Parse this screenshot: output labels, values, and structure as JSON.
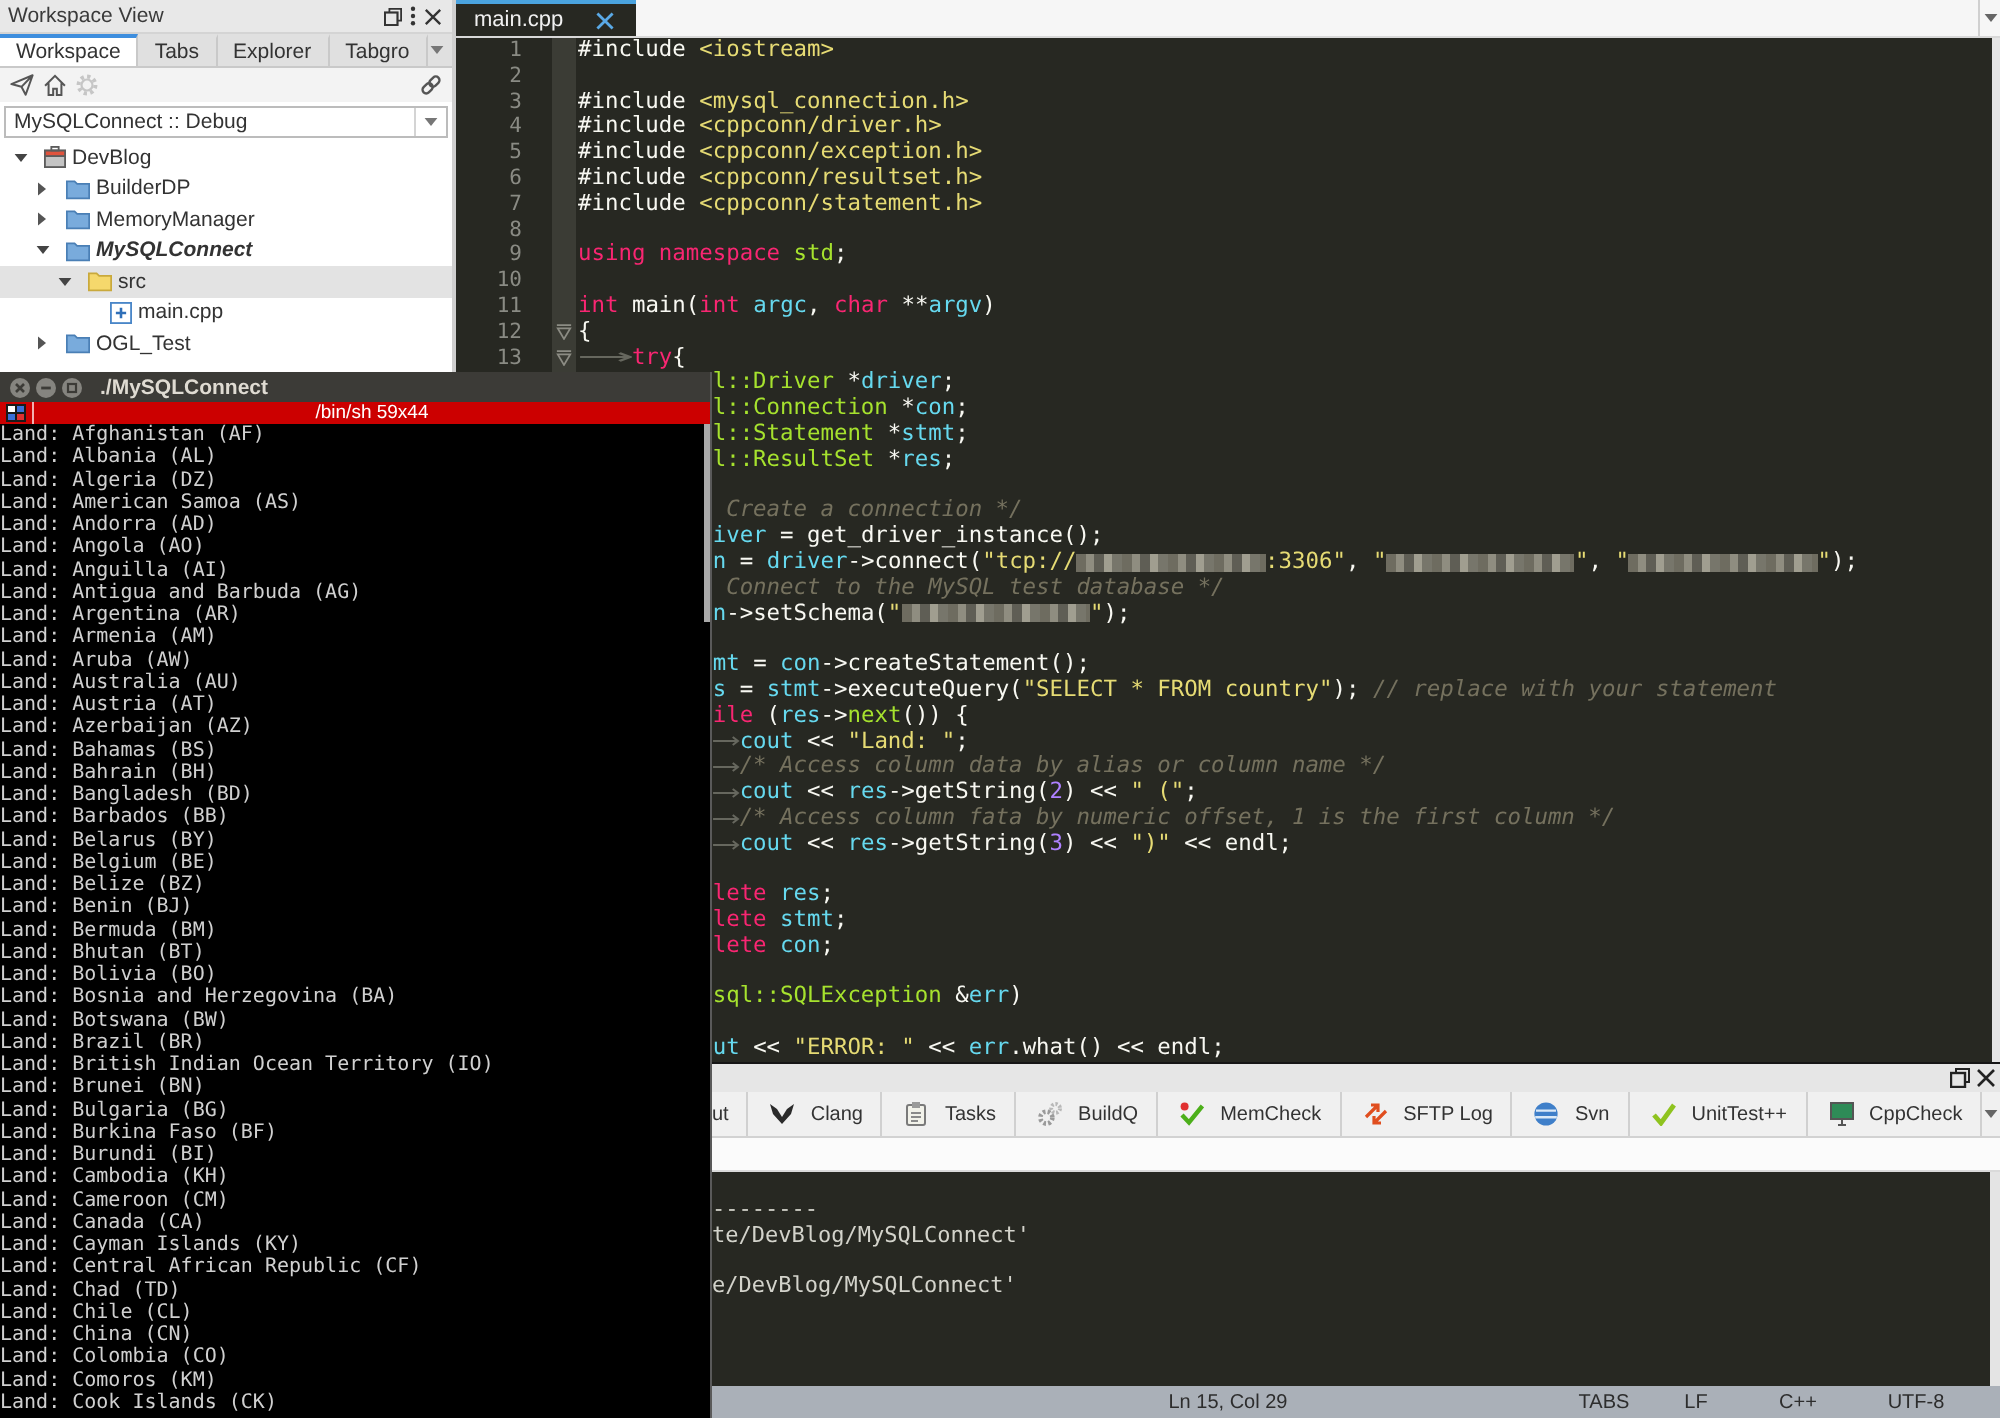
{
  "workspace_view": {
    "title": "Workspace View",
    "tabs": [
      {
        "label": "Workspace",
        "selected": true
      },
      {
        "label": "Tabs",
        "selected": false
      },
      {
        "label": "Explorer",
        "selected": false
      },
      {
        "label": "Tabgro",
        "selected": false
      }
    ],
    "toolbar": {
      "start": [
        {
          "kind": "plane",
          "disabled": false
        },
        {
          "kind": "home",
          "disabled": false
        },
        {
          "kind": "gear",
          "disabled": true
        }
      ],
      "end": [
        {
          "kind": "link",
          "disabled": false
        }
      ]
    },
    "configuration": "MySQLConnect :: Debug",
    "tree": [
      {
        "label": "DevBlog",
        "kind": "workspace",
        "expanded": true,
        "selected": false,
        "active": false,
        "children": [
          {
            "label": "BuilderDP",
            "kind": "project",
            "expanded": false,
            "selected": false,
            "active": false
          },
          {
            "label": "MemoryManager",
            "kind": "project",
            "expanded": false,
            "selected": false,
            "active": false
          },
          {
            "label": "MySQLConnect",
            "kind": "project",
            "expanded": true,
            "selected": false,
            "active": true,
            "children": [
              {
                "label": "src",
                "kind": "folder",
                "expanded": true,
                "selected": true,
                "active": false,
                "children": [
                  {
                    "label": "main.cpp",
                    "kind": "file",
                    "selected": false,
                    "active": false
                  }
                ]
              }
            ]
          },
          {
            "label": "OGL_Test",
            "kind": "project",
            "expanded": false,
            "selected": false,
            "active": false
          }
        ]
      }
    ]
  },
  "editor": {
    "tabs": [
      {
        "label": "main.cpp",
        "selected": true
      }
    ],
    "lines": [
      {
        "number": "1",
        "fold": false,
        "tokens": [
          {
            "kind": "plain",
            "text": "#include "
          },
          {
            "kind": "string",
            "text": "<iostream>"
          }
        ]
      },
      {
        "number": "2",
        "fold": false
      },
      {
        "number": "3",
        "fold": false,
        "tokens": [
          {
            "kind": "plain",
            "text": "#include "
          },
          {
            "kind": "string",
            "text": "<mysql_connection.h>"
          }
        ]
      },
      {
        "number": "4",
        "fold": false,
        "tokens": [
          {
            "kind": "plain",
            "text": "#include "
          },
          {
            "kind": "string",
            "text": "<cppconn/driver.h>"
          }
        ]
      },
      {
        "number": "5",
        "fold": false,
        "tokens": [
          {
            "kind": "plain",
            "text": "#include "
          },
          {
            "kind": "string",
            "text": "<cppconn/exception.h>"
          }
        ]
      },
      {
        "number": "6",
        "fold": false,
        "tokens": [
          {
            "kind": "plain",
            "text": "#include "
          },
          {
            "kind": "string",
            "text": "<cppconn/resultset.h>"
          }
        ]
      },
      {
        "number": "7",
        "fold": false,
        "tokens": [
          {
            "kind": "plain",
            "text": "#include "
          },
          {
            "kind": "string",
            "text": "<cppconn/statement.h>"
          }
        ]
      },
      {
        "number": "8",
        "fold": false
      },
      {
        "number": "9",
        "fold": false,
        "tokens": [
          {
            "kind": "keyword",
            "text": "using"
          },
          {
            "kind": "keyword",
            "text": " namespace"
          },
          {
            "kind": "type",
            "text": " std"
          },
          {
            "kind": "plain",
            "text": ";"
          }
        ]
      },
      {
        "number": "10",
        "fold": false
      },
      {
        "number": "11",
        "fold": false,
        "tokens": [
          {
            "kind": "keyword",
            "text": "int"
          },
          {
            "kind": "plain",
            "text": " main("
          },
          {
            "kind": "keyword",
            "text": "int"
          },
          {
            "kind": "ident",
            "text": " argc"
          },
          {
            "kind": "plain",
            "text": ", "
          },
          {
            "kind": "keyword",
            "text": "char"
          },
          {
            "kind": "plain",
            "text": " **"
          },
          {
            "kind": "ident",
            "text": "argv"
          },
          {
            "kind": "plain",
            "text": ")"
          }
        ]
      },
      {
        "number": "12",
        "fold": true,
        "tokens": [
          {
            "kind": "plain",
            "text": "{"
          }
        ]
      },
      {
        "number": "13",
        "fold": true,
        "tokens": [
          {
            "kind": "tab"
          },
          {
            "kind": "keyword",
            "text": "try"
          },
          {
            "kind": "plain",
            "text": "{"
          }
        ]
      }
    ],
    "clipped_blocks": [
      {
        "lines": [
          {
            "tokens": [
              {
                "kind": "type",
                "text": "l::Driver"
              },
              {
                "kind": "plain",
                "text": " *"
              },
              {
                "kind": "ident",
                "text": "driver"
              },
              {
                "kind": "plain",
                "text": ";"
              }
            ]
          },
          {
            "tokens": [
              {
                "kind": "type",
                "text": "l::Connection"
              },
              {
                "kind": "plain",
                "text": " *"
              },
              {
                "kind": "ident",
                "text": "con"
              },
              {
                "kind": "plain",
                "text": ";"
              }
            ]
          },
          {
            "tokens": [
              {
                "kind": "type",
                "text": "l::Statement"
              },
              {
                "kind": "plain",
                "text": " *"
              },
              {
                "kind": "ident",
                "text": "stmt"
              },
              {
                "kind": "plain",
                "text": ";"
              }
            ]
          },
          {
            "tokens": [
              {
                "kind": "type",
                "text": "l::ResultSet"
              },
              {
                "kind": "plain",
                "text": " *"
              },
              {
                "kind": "ident",
                "text": "res"
              },
              {
                "kind": "plain",
                "text": ";"
              }
            ]
          }
        ]
      },
      {
        "lines": [
          {
            "tokens": [
              {
                "kind": "comment",
                "text": " Create a connection */"
              }
            ]
          },
          {
            "tokens": [
              {
                "kind": "ident",
                "text": "iver"
              },
              {
                "kind": "plain",
                "text": " = get_driver_instance();"
              }
            ]
          },
          {
            "tokens": [
              {
                "kind": "ident",
                "text": "n"
              },
              {
                "kind": "plain",
                "text": " = "
              },
              {
                "kind": "ident",
                "text": "driver"
              },
              {
                "kind": "plain",
                "text": "->connect("
              },
              {
                "kind": "string",
                "text": "\"tcp://"
              },
              {
                "kind": "redacted"
              },
              {
                "kind": "string",
                "text": ":3306\""
              },
              {
                "kind": "plain",
                "text": ", "
              },
              {
                "kind": "string",
                "text": "\""
              },
              {
                "kind": "redacted"
              },
              {
                "kind": "string",
                "text": "\""
              },
              {
                "kind": "plain",
                "text": ", "
              },
              {
                "kind": "string",
                "text": "\""
              },
              {
                "kind": "redacted"
              },
              {
                "kind": "string",
                "text": "\""
              },
              {
                "kind": "plain",
                "text": ");"
              }
            ]
          },
          {
            "tokens": [
              {
                "kind": "comment",
                "text": " Connect to the MySQL test database */"
              }
            ]
          },
          {
            "tokens": [
              {
                "kind": "ident",
                "text": "n"
              },
              {
                "kind": "plain",
                "text": "->setSchema("
              },
              {
                "kind": "string",
                "text": "\""
              },
              {
                "kind": "redacted"
              },
              {
                "kind": "string",
                "text": "\""
              },
              {
                "kind": "plain",
                "text": ");"
              }
            ]
          }
        ]
      },
      {
        "lines": [
          {
            "tokens": [
              {
                "kind": "ident",
                "text": "mt"
              },
              {
                "kind": "plain",
                "text": " = "
              },
              {
                "kind": "ident",
                "text": "con"
              },
              {
                "kind": "plain",
                "text": "->createStatement();"
              }
            ]
          },
          {
            "tokens": [
              {
                "kind": "ident",
                "text": "s"
              },
              {
                "kind": "plain",
                "text": " = "
              },
              {
                "kind": "ident",
                "text": "stmt"
              },
              {
                "kind": "plain",
                "text": "->executeQuery("
              },
              {
                "kind": "string",
                "text": "\"SELECT * FROM country\""
              },
              {
                "kind": "plain",
                "text": "); "
              },
              {
                "kind": "comment",
                "text": "// replace with your statement"
              }
            ]
          },
          {
            "tokens": [
              {
                "kind": "keyword",
                "text": "ile"
              },
              {
                "kind": "plain",
                "text": " ("
              },
              {
                "kind": "ident",
                "text": "res"
              },
              {
                "kind": "plain",
                "text": "->"
              },
              {
                "kind": "function",
                "text": "next"
              },
              {
                "kind": "plain",
                "text": "()) {"
              }
            ]
          },
          {
            "tokens": [
              {
                "kind": "tab"
              },
              {
                "kind": "ident",
                "text": "cout"
              },
              {
                "kind": "plain",
                "text": " << "
              },
              {
                "kind": "string",
                "text": "\"Land: \""
              },
              {
                "kind": "plain",
                "text": ";"
              }
            ]
          },
          {
            "tokens": [
              {
                "kind": "tab"
              },
              {
                "kind": "comment",
                "text": "/* Access column data by alias or column name */"
              }
            ]
          },
          {
            "tokens": [
              {
                "kind": "tab"
              },
              {
                "kind": "ident",
                "text": "cout"
              },
              {
                "kind": "plain",
                "text": " << "
              },
              {
                "kind": "ident",
                "text": "res"
              },
              {
                "kind": "plain",
                "text": "->getString("
              },
              {
                "kind": "number",
                "text": "2"
              },
              {
                "kind": "plain",
                "text": ") << "
              },
              {
                "kind": "string",
                "text": "\" (\""
              },
              {
                "kind": "plain",
                "text": ";"
              }
            ]
          },
          {
            "tokens": [
              {
                "kind": "tab"
              },
              {
                "kind": "comment",
                "text": "/* Access column fata by numeric offset, 1 is the first column */"
              }
            ]
          },
          {
            "tokens": [
              {
                "kind": "tab"
              },
              {
                "kind": "ident",
                "text": "cout"
              },
              {
                "kind": "plain",
                "text": " << "
              },
              {
                "kind": "ident",
                "text": "res"
              },
              {
                "kind": "plain",
                "text": "->getString("
              },
              {
                "kind": "number",
                "text": "3"
              },
              {
                "kind": "plain",
                "text": ") << "
              },
              {
                "kind": "string",
                "text": "\")\""
              },
              {
                "kind": "plain",
                "text": " << endl;"
              }
            ]
          }
        ]
      },
      {
        "lines": [
          {
            "tokens": [
              {
                "kind": "keyword",
                "text": "lete"
              },
              {
                "kind": "ident",
                "text": " res"
              },
              {
                "kind": "plain",
                "text": ";"
              }
            ]
          },
          {
            "tokens": [
              {
                "kind": "keyword",
                "text": "lete"
              },
              {
                "kind": "ident",
                "text": " stmt"
              },
              {
                "kind": "plain",
                "text": ";"
              }
            ]
          },
          {
            "tokens": [
              {
                "kind": "keyword",
                "text": "lete"
              },
              {
                "kind": "ident",
                "text": " con"
              },
              {
                "kind": "plain",
                "text": ";"
              }
            ]
          }
        ]
      },
      {
        "lines": [
          {
            "tokens": [
              {
                "kind": "type",
                "text": "sql::SQLException"
              },
              {
                "kind": "plain",
                "text": " &"
              },
              {
                "kind": "ident",
                "text": "err"
              },
              {
                "kind": "plain",
                "text": ")"
              }
            ]
          }
        ]
      },
      {
        "lines": [
          {
            "tokens": [
              {
                "kind": "ident",
                "text": "ut"
              },
              {
                "kind": "plain",
                "text": " << "
              },
              {
                "kind": "string",
                "text": "\"ERROR: \""
              },
              {
                "kind": "plain",
                "text": " << "
              },
              {
                "kind": "ident",
                "text": "err"
              },
              {
                "kind": "plain",
                "text": ".what() << endl;"
              }
            ]
          }
        ]
      }
    ]
  },
  "output_pane": {
    "tabs": [
      {
        "label": "ut",
        "kind": "none",
        "selected": false
      },
      {
        "label": "Clang",
        "kind": "wings",
        "selected": false
      },
      {
        "label": "Tasks",
        "kind": "clipboard",
        "selected": false
      },
      {
        "label": "BuildQ",
        "kind": "gears",
        "selected": false
      },
      {
        "label": "MemCheck",
        "kind": "check-dot",
        "selected": false
      },
      {
        "label": "SFTP Log",
        "kind": "arrows",
        "selected": false
      },
      {
        "label": "Svn",
        "kind": "globe",
        "selected": false
      },
      {
        "label": "UnitTest++",
        "kind": "check",
        "selected": false
      },
      {
        "label": "CppCheck",
        "kind": "monitor",
        "selected": false
      }
    ],
    "blocks": [
      {
        "lines": [
          "--------",
          "te/DevBlog/MySQLConnect'"
        ]
      },
      {
        "lines": [
          "e/DevBlog/MySQLConnect'"
        ]
      }
    ]
  },
  "status_bar": {
    "cursor": "Ln 15, Col 29",
    "indentation": "TABS",
    "line_ending": "LF",
    "language": "C++",
    "encoding": "UTF-8"
  },
  "terminal": {
    "title": "./MySQLConnect",
    "status": "/bin/sh 59x44",
    "lines": [
      "Land: Afghanistan (AF)",
      "Land: Albania (AL)",
      "Land: Algeria (DZ)",
      "Land: American Samoa (AS)",
      "Land: Andorra (AD)",
      "Land: Angola (AO)",
      "Land: Anguilla (AI)",
      "Land: Antigua and Barbuda (AG)",
      "Land: Argentina (AR)",
      "Land: Armenia (AM)",
      "Land: Aruba (AW)",
      "Land: Australia (AU)",
      "Land: Austria (AT)",
      "Land: Azerbaijan (AZ)",
      "Land: Bahamas (BS)",
      "Land: Bahrain (BH)",
      "Land: Bangladesh (BD)",
      "Land: Barbados (BB)",
      "Land: Belarus (BY)",
      "Land: Belgium (BE)",
      "Land: Belize (BZ)",
      "Land: Benin (BJ)",
      "Land: Bermuda (BM)",
      "Land: Bhutan (BT)",
      "Land: Bolivia (BO)",
      "Land: Bosnia and Herzegovina (BA)",
      "Land: Botswana (BW)",
      "Land: Brazil (BR)",
      "Land: British Indian Ocean Territory (IO)",
      "Land: Brunei (BN)",
      "Land: Bulgaria (BG)",
      "Land: Burkina Faso (BF)",
      "Land: Burundi (BI)",
      "Land: Cambodia (KH)",
      "Land: Cameroon (CM)",
      "Land: Canada (CA)",
      "Land: Cayman Islands (KY)",
      "Land: Central African Republic (CF)",
      "Land: Chad (TD)",
      "Land: Chile (CL)",
      "Land: China (CN)",
      "Land: Colombia (CO)",
      "Land: Comoros (KM)",
      "Land: Cook Islands (CK)"
    ]
  }
}
